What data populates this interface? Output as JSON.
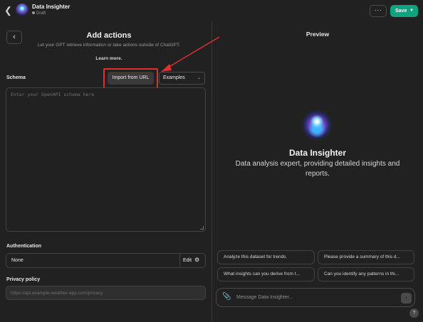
{
  "header": {
    "gpt_name": "Data Insighter",
    "gpt_status": "Draft",
    "more_label": "···",
    "save_label": "Save"
  },
  "actions_panel": {
    "title": "Add actions",
    "description": "Let your GPT retrieve information or take actions outside of ChatGPT.",
    "learn_more": "Learn more.",
    "schema_label": "Schema",
    "import_button": "Import from URL",
    "examples_label": "Examples",
    "schema_placeholder": "Enter your OpenAPI schema here",
    "auth_label": "Authentication",
    "auth_value": "None",
    "auth_edit": "Edit",
    "privacy_label": "Privacy policy",
    "privacy_placeholder": "https://api.example-weather-app.com/privacy"
  },
  "preview": {
    "title": "Preview",
    "bot_name": "Data Insighter",
    "bot_description": "Data analysis expert, providing detailed insights and reports.",
    "suggestions": [
      "Analyze this dataset for trends.",
      "Please provide a summary of this d...",
      "What insights can you derive from t...",
      "Can you identify any patterns in thi..."
    ],
    "composer_placeholder": "Message Data Insighter...",
    "help_label": "?"
  },
  "icons": {
    "back": "chevron-left-icon",
    "gear": "gear-icon",
    "paperclip": "paperclip-icon",
    "send": "arrow-up-icon"
  },
  "colors": {
    "background": "#212121",
    "save_button": "#10a37f",
    "annotation": "#e12f2f"
  }
}
